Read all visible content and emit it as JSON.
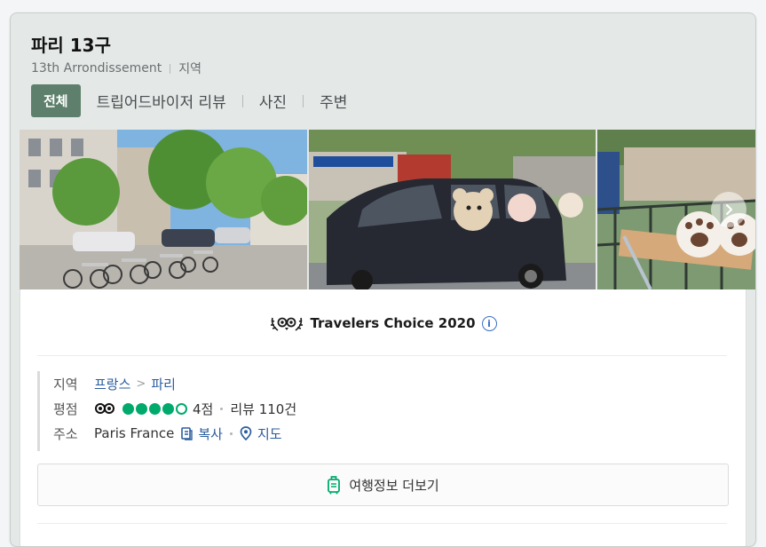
{
  "header": {
    "title": "파리 13구",
    "subtitle_name": "13th Arrondissement",
    "subtitle_type": "지역"
  },
  "tabs": [
    {
      "label": "전체",
      "active": true
    },
    {
      "label": "트립어드바이저 리뷰",
      "active": false
    },
    {
      "label": "사진",
      "active": false
    },
    {
      "label": "주변",
      "active": false
    }
  ],
  "photos": {
    "next_icon": "chevron-right-icon"
  },
  "award": {
    "label": "Travelers Choice 2020",
    "info_icon": "info-icon",
    "info_glyph": "i"
  },
  "details": {
    "region": {
      "label": "지역",
      "crumbs": [
        "프랑스",
        "파리"
      ],
      "separator": ">"
    },
    "rating": {
      "label": "평점",
      "bubbles_filled": 4,
      "bubbles_total": 5,
      "score_text": "4점",
      "reviews_text": "리뷰 110건"
    },
    "address": {
      "label": "주소",
      "value": "Paris France",
      "copy_label": "복사",
      "map_label": "지도"
    }
  },
  "more_button": {
    "label": "여행정보 더보기",
    "icon": "luggage-icon"
  },
  "colors": {
    "accent_green": "#00aa6c",
    "tab_active_bg": "#5d7f6b",
    "link_blue": "#2b5e9e"
  }
}
